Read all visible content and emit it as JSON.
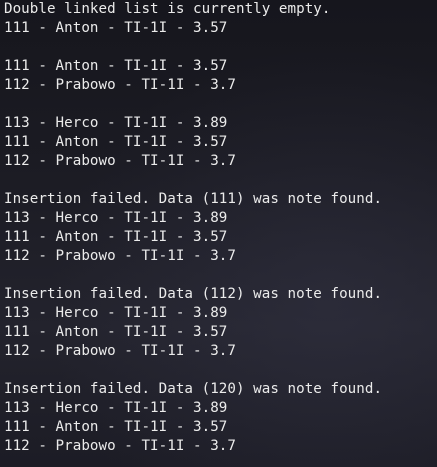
{
  "terminal": {
    "lines": [
      "Double linked list is currently empty.",
      "111 - Anton - TI-1I - 3.57",
      "",
      "111 - Anton - TI-1I - 3.57",
      "112 - Prabowo - TI-1I - 3.7",
      "",
      "113 - Herco - TI-1I - 3.89",
      "111 - Anton - TI-1I - 3.57",
      "112 - Prabowo - TI-1I - 3.7",
      "",
      "Insertion failed. Data (111) was note found.",
      "113 - Herco - TI-1I - 3.89",
      "111 - Anton - TI-1I - 3.57",
      "112 - Prabowo - TI-1I - 3.7",
      "",
      "Insertion failed. Data (112) was note found.",
      "113 - Herco - TI-1I - 3.89",
      "111 - Anton - TI-1I - 3.57",
      "112 - Prabowo - TI-1I - 3.7",
      "",
      "Insertion failed. Data (120) was note found.",
      "113 - Herco - TI-1I - 3.89",
      "111 - Anton - TI-1I - 3.57",
      "112 - Prabowo - TI-1I - 3.7"
    ]
  }
}
